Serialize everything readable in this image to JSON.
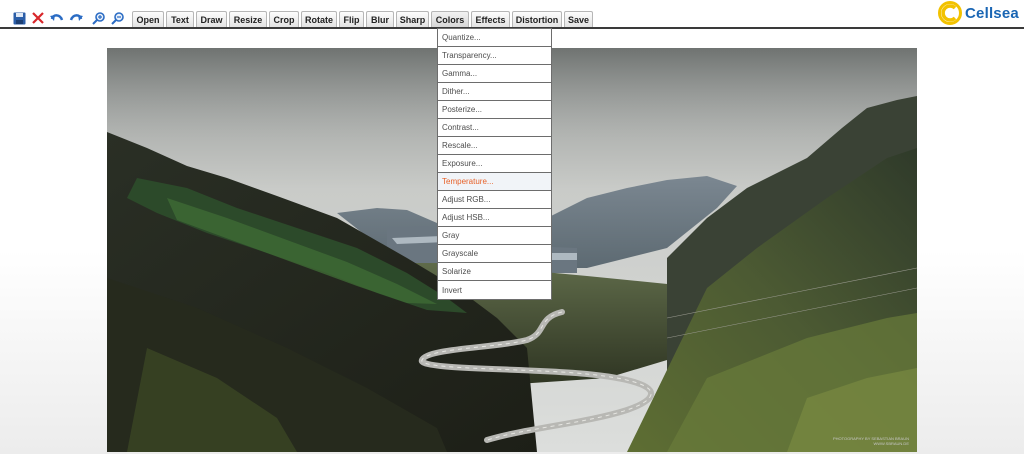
{
  "toolbar": {
    "icons": [
      "save-icon",
      "close-icon",
      "undo-icon",
      "redo-icon",
      "zoom-in-icon",
      "zoom-out-icon"
    ],
    "buttons": {
      "open": "Open",
      "text": "Text",
      "draw": "Draw",
      "resize": "Resize",
      "crop": "Crop",
      "rotate": "Rotate",
      "flip": "Flip",
      "blur": "Blur",
      "sharp": "Sharp",
      "colors": "Colors",
      "effects": "Effects",
      "distortion": "Distortion",
      "save": "Save"
    }
  },
  "logo": {
    "text": "Cellsea"
  },
  "colors_menu": {
    "items": [
      "Quantize...",
      "Transparency...",
      "Gamma...",
      "Dither...",
      "Posterize...",
      "Contrast...",
      "Rescale...",
      "Exposure...",
      "Temperature...",
      "Adjust RGB...",
      "Adjust HSB...",
      "Gray",
      "Grayscale",
      "Solarize",
      "Invert"
    ],
    "highlighted": "Temperature..."
  },
  "photo": {
    "description_icon": "landscape-photo",
    "watermark_line1": "PHOTOGRAPHY BY SEBASTIAN BRAUN",
    "watermark_line2": "WWW.SBRAUN.DE"
  },
  "theme": {
    "accent": "#1a66b4",
    "logo_yellow": "#f2c200",
    "highlight_text": "#e7622a"
  }
}
